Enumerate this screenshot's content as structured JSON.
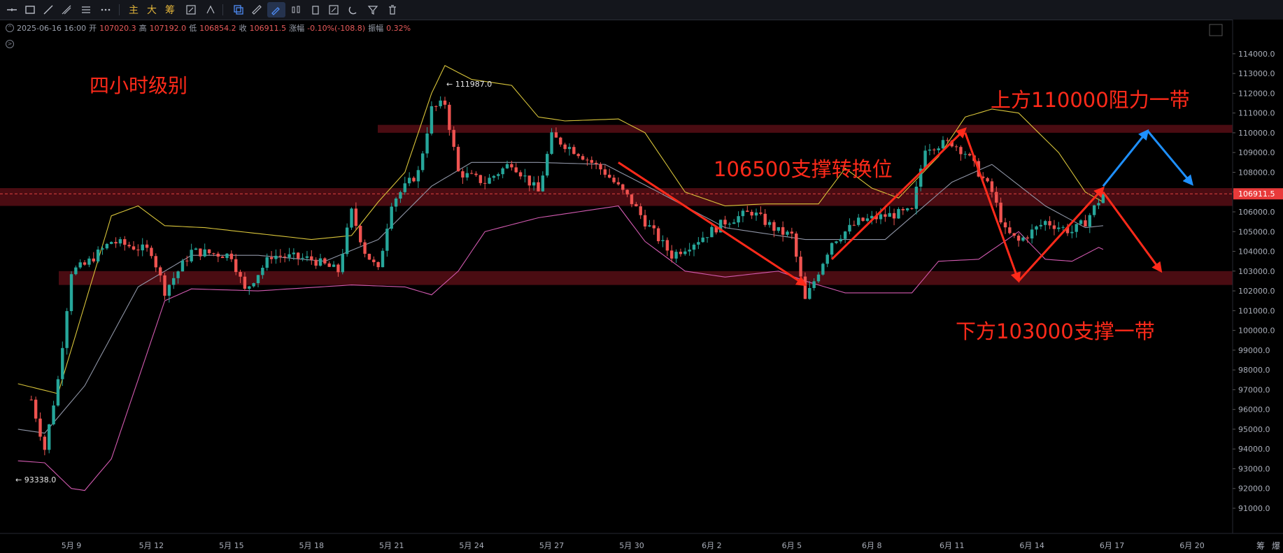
{
  "toolbar": {
    "tools": [
      "horizontal-line-icon",
      "rectangle-icon",
      "trend-line-icon",
      "ray-icon",
      "parallel-lines-icon",
      "more-icon"
    ],
    "text_buttons": [
      "主",
      "大",
      "筹"
    ]
  },
  "info": {
    "datetime": "2025-06-16 16:00",
    "open_label": "开",
    "open": "107020.3",
    "high_label": "高",
    "high": "107192.0",
    "low_label": "低",
    "low": "106854.2",
    "close_label": "收",
    "close": "106911.5",
    "change_label": "涨幅",
    "change": "-0.10%(-108.8)",
    "amp_label": "振幅",
    "amp": "0.32%"
  },
  "colors": {
    "up": "#26a69a",
    "down": "#ef5350",
    "upper_band": "#d8c43a",
    "mid_band": "#8f95a6",
    "lower_band": "#d25ab0",
    "zone": "#4a0c12",
    "annotation": "#ff2a1a",
    "arrow_blue": "#1e90ff"
  },
  "chart_data": {
    "type": "candlestick",
    "title": "四小时级别",
    "y_ticks": [
      91000,
      92000,
      93000,
      94000,
      95000,
      96000,
      97000,
      98000,
      99000,
      100000,
      101000,
      102000,
      103000,
      104000,
      105000,
      106000,
      107000,
      108000,
      109000,
      110000,
      111000,
      112000,
      113000,
      114000
    ],
    "ylim": [
      90600,
      114600
    ],
    "x_ticks": [
      "5月 9",
      "5月 12",
      "5月 15",
      "5月 18",
      "5月 21",
      "5月 24",
      "5月 27",
      "5月 30",
      "6月 2",
      "6月 5",
      "6月 8",
      "6月 11",
      "6月 14",
      "6月 17",
      "6月 20"
    ],
    "last_price": "106911.5",
    "high_marker": "← 111987.0",
    "low_marker": "← 93338.0",
    "annotations": [
      "上方110000阻力一带",
      "106500支撑转换位",
      "下方103000支撑一带"
    ],
    "zones": [
      {
        "from": 110000,
        "to": 110400
      },
      {
        "from": 106300,
        "to": 107200
      },
      {
        "from": 102300,
        "to": 103000
      }
    ],
    "anchors": [
      {
        "x": "5月 7 12:00",
        "y": 96500
      },
      {
        "x": "5月 8 00:00",
        "y": 94000
      },
      {
        "x": "5月 8 12:00",
        "y": 97500
      },
      {
        "x": "5月 9 00:00",
        "y": 103000
      },
      {
        "x": "5月 9 12:00",
        "y": 103300
      },
      {
        "x": "5月 10 12:00",
        "y": 104500
      },
      {
        "x": "5月 12 00:00",
        "y": 104000
      },
      {
        "x": "5月 12 12:00",
        "y": 102000
      },
      {
        "x": "5月 13 12:00",
        "y": 104000
      },
      {
        "x": "5月 15 00:00",
        "y": 103800
      },
      {
        "x": "5月 15 12:00",
        "y": 102000
      },
      {
        "x": "5月 16 12:00",
        "y": 103800
      },
      {
        "x": "5月 18 00:00",
        "y": 103600
      },
      {
        "x": "5月 19 00:00",
        "y": 103000
      },
      {
        "x": "5月 19 12:00",
        "y": 106000
      },
      {
        "x": "5月 20 00:00",
        "y": 104000
      },
      {
        "x": "5月 20 12:00",
        "y": 103000
      },
      {
        "x": "5月 21 00:00",
        "y": 106500
      },
      {
        "x": "5月 22 00:00",
        "y": 108000
      },
      {
        "x": "5月 22 12:00",
        "y": 111200
      },
      {
        "x": "5月 23 00:00",
        "y": 111500
      },
      {
        "x": "5月 23 12:00",
        "y": 108000
      },
      {
        "x": "5月 24 12:00",
        "y": 107500
      },
      {
        "x": "5月 25 12:00",
        "y": 108500
      },
      {
        "x": "5月 26 12:00",
        "y": 107000
      },
      {
        "x": "5月 27 00:00",
        "y": 109800
      },
      {
        "x": "5月 28 00:00",
        "y": 109000
      },
      {
        "x": "5月 29 00:00",
        "y": 108000
      },
      {
        "x": "5月 30 00:00",
        "y": 106500
      },
      {
        "x": "5月 30 12:00",
        "y": 105500
      },
      {
        "x": "5月 31 12:00",
        "y": 103800
      },
      {
        "x": "6月 1 12:00",
        "y": 104600
      },
      {
        "x": "6月 2 12:00",
        "y": 105500
      },
      {
        "x": "6月 3 12:00",
        "y": 106000
      },
      {
        "x": "6月 4 12:00",
        "y": 105000
      },
      {
        "x": "6月 5 00:00",
        "y": 104800
      },
      {
        "x": "6月 5 12:00",
        "y": 101500
      },
      {
        "x": "6月 6 12:00",
        "y": 104500
      },
      {
        "x": "6月 7 12:00",
        "y": 105500
      },
      {
        "x": "6月 8 12:00",
        "y": 105800
      },
      {
        "x": "6月 9 12:00",
        "y": 106000
      },
      {
        "x": "6月 10 00:00",
        "y": 109300
      },
      {
        "x": "6月 11 00:00",
        "y": 109500
      },
      {
        "x": "6月 11 12:00",
        "y": 109000
      },
      {
        "x": "6月 12 12:00",
        "y": 107000
      },
      {
        "x": "6月 13 00:00",
        "y": 105000
      },
      {
        "x": "6月 13 12:00",
        "y": 104500
      },
      {
        "x": "6月 14 12:00",
        "y": 105500
      },
      {
        "x": "6月 15 12:00",
        "y": 105000
      },
      {
        "x": "6月 16 00:00",
        "y": 105500
      },
      {
        "x": "6月 16 16:00",
        "y": 106900
      }
    ],
    "bands": {
      "upper": [
        {
          "x": "5月 7 00:00",
          "y": 97300
        },
        {
          "x": "5月 8 12:00",
          "y": 96800
        },
        {
          "x": "5月 10 12:00",
          "y": 105800
        },
        {
          "x": "5月 11 12:00",
          "y": 106300
        },
        {
          "x": "5月 12 12:00",
          "y": 105300
        },
        {
          "x": "5月 14 00:00",
          "y": 105200
        },
        {
          "x": "5月 16 00:00",
          "y": 104900
        },
        {
          "x": "5月 18 00:00",
          "y": 104600
        },
        {
          "x": "5月 19 12:00",
          "y": 104800
        },
        {
          "x": "5月 20 12:00",
          "y": 106500
        },
        {
          "x": "5月 21 12:00",
          "y": 108000
        },
        {
          "x": "5月 22 12:00",
          "y": 112000
        },
        {
          "x": "5月 23 00:00",
          "y": 113400
        },
        {
          "x": "5月 24 00:00",
          "y": 112700
        },
        {
          "x": "5月 25 12:00",
          "y": 112400
        },
        {
          "x": "5月 26 12:00",
          "y": 110800
        },
        {
          "x": "5月 27 12:00",
          "y": 110600
        },
        {
          "x": "5月 29 12:00",
          "y": 110700
        },
        {
          "x": "5月 30 12:00",
          "y": 110000
        },
        {
          "x": "6月 1 00:00",
          "y": 107000
        },
        {
          "x": "6月 2 12:00",
          "y": 106300
        },
        {
          "x": "6月 4 00:00",
          "y": 106400
        },
        {
          "x": "6月 6 00:00",
          "y": 106400
        },
        {
          "x": "6月 7 00:00",
          "y": 108200
        },
        {
          "x": "6月 8 00:00",
          "y": 107200
        },
        {
          "x": "6月 9 00:00",
          "y": 106700
        },
        {
          "x": "6月 10 12:00",
          "y": 108800
        },
        {
          "x": "6月 11 12:00",
          "y": 110800
        },
        {
          "x": "6月 12 12:00",
          "y": 111200
        },
        {
          "x": "6月 13 12:00",
          "y": 111000
        },
        {
          "x": "6月 15 00:00",
          "y": 109000
        },
        {
          "x": "6月 16 00:00",
          "y": 107000
        },
        {
          "x": "6月 16 16:00",
          "y": 106500
        }
      ],
      "mid": [
        {
          "x": "5月 7 00:00",
          "y": 95000
        },
        {
          "x": "5月 8 00:00",
          "y": 94800
        },
        {
          "x": "5月 9 12:00",
          "y": 97200
        },
        {
          "x": "5月 11 12:00",
          "y": 102200
        },
        {
          "x": "5月 13 12:00",
          "y": 103800
        },
        {
          "x": "5月 16 00:00",
          "y": 103800
        },
        {
          "x": "5月 18 12:00",
          "y": 103500
        },
        {
          "x": "5月 20 12:00",
          "y": 104600
        },
        {
          "x": "5月 22 12:00",
          "y": 107300
        },
        {
          "x": "5月 24 00:00",
          "y": 108500
        },
        {
          "x": "5月 26 12:00",
          "y": 108500
        },
        {
          "x": "5月 29 00:00",
          "y": 108400
        },
        {
          "x": "5月 31 00:00",
          "y": 107000
        },
        {
          "x": "6月 2 12:00",
          "y": 105200
        },
        {
          "x": "6月 5 12:00",
          "y": 104600
        },
        {
          "x": "6月 8 12:00",
          "y": 104600
        },
        {
          "x": "6月 11 00:00",
          "y": 107500
        },
        {
          "x": "6月 12 12:00",
          "y": 108400
        },
        {
          "x": "6月 14 12:00",
          "y": 106300
        },
        {
          "x": "6月 16 00:00",
          "y": 105200
        },
        {
          "x": "6月 16 16:00",
          "y": 105300
        }
      ],
      "lower": [
        {
          "x": "5月 7 00:00",
          "y": 93400
        },
        {
          "x": "5月 8 00:00",
          "y": 93300
        },
        {
          "x": "5月 9 00:00",
          "y": 92000
        },
        {
          "x": "5月 9 12:00",
          "y": 91900
        },
        {
          "x": "5月 10 12:00",
          "y": 93500
        },
        {
          "x": "5月 11 12:00",
          "y": 97500
        },
        {
          "x": "5月 12 12:00",
          "y": 101500
        },
        {
          "x": "5月 13 12:00",
          "y": 102100
        },
        {
          "x": "5月 16 00:00",
          "y": 102000
        },
        {
          "x": "5月 19 12:00",
          "y": 102300
        },
        {
          "x": "5月 21 12:00",
          "y": 102200
        },
        {
          "x": "5月 22 12:00",
          "y": 101800
        },
        {
          "x": "5月 23 12:00",
          "y": 103000
        },
        {
          "x": "5月 24 12:00",
          "y": 105000
        },
        {
          "x": "5月 26 12:00",
          "y": 105700
        },
        {
          "x": "5月 28 00:00",
          "y": 106000
        },
        {
          "x": "5月 29 12:00",
          "y": 106300
        },
        {
          "x": "5月 30 12:00",
          "y": 104500
        },
        {
          "x": "6月 1 00:00",
          "y": 103000
        },
        {
          "x": "6月 2 12:00",
          "y": 102700
        },
        {
          "x": "6月 4 12:00",
          "y": 103000
        },
        {
          "x": "6月 5 12:00",
          "y": 102500
        },
        {
          "x": "6月 7 00:00",
          "y": 101900
        },
        {
          "x": "6月 9 12:00",
          "y": 101900
        },
        {
          "x": "6月 10 12:00",
          "y": 103500
        },
        {
          "x": "6月 12 00:00",
          "y": 103600
        },
        {
          "x": "6月 13 12:00",
          "y": 105000
        },
        {
          "x": "6月 14 12:00",
          "y": 103600
        },
        {
          "x": "6月 15 12:00",
          "y": 103500
        },
        {
          "x": "6月 16 12:00",
          "y": 104200
        },
        {
          "x": "6月 16 16:00",
          "y": 104100
        }
      ]
    },
    "arrows": [
      {
        "from": {
          "x": "5月 29 12:00",
          "y": 108500
        },
        "to": {
          "x": "6月 5 12:00",
          "y": 102300
        },
        "color": "red"
      },
      {
        "from": {
          "x": "6月 6 12:00",
          "y": 103600
        },
        "to": {
          "x": "6月 11 12:00",
          "y": 110200
        },
        "color": "red"
      },
      {
        "from": {
          "x": "6月 11 12:00",
          "y": 110000
        },
        "to": {
          "x": "6月 13 12:00",
          "y": 102500
        },
        "color": "red"
      },
      {
        "from": {
          "x": "6月 13 12:00",
          "y": 102500
        },
        "to": {
          "x": "6月 16 16:00",
          "y": 107200
        },
        "color": "red"
      },
      {
        "from": {
          "x": "6月 16 16:00",
          "y": 107000
        },
        "to": {
          "x": "6月 18 20:00",
          "y": 103000
        },
        "color": "red"
      },
      {
        "from": {
          "x": "6月 16 16:00",
          "y": 107300
        },
        "to": {
          "x": "6月 18 08:00",
          "y": 110100
        },
        "color": "blue"
      },
      {
        "from": {
          "x": "6月 18 08:00",
          "y": 110100
        },
        "to": {
          "x": "6月 20 00:00",
          "y": 107400
        },
        "color": "blue"
      }
    ],
    "x_axis_right_labels": [
      "筹",
      "爆"
    ]
  }
}
